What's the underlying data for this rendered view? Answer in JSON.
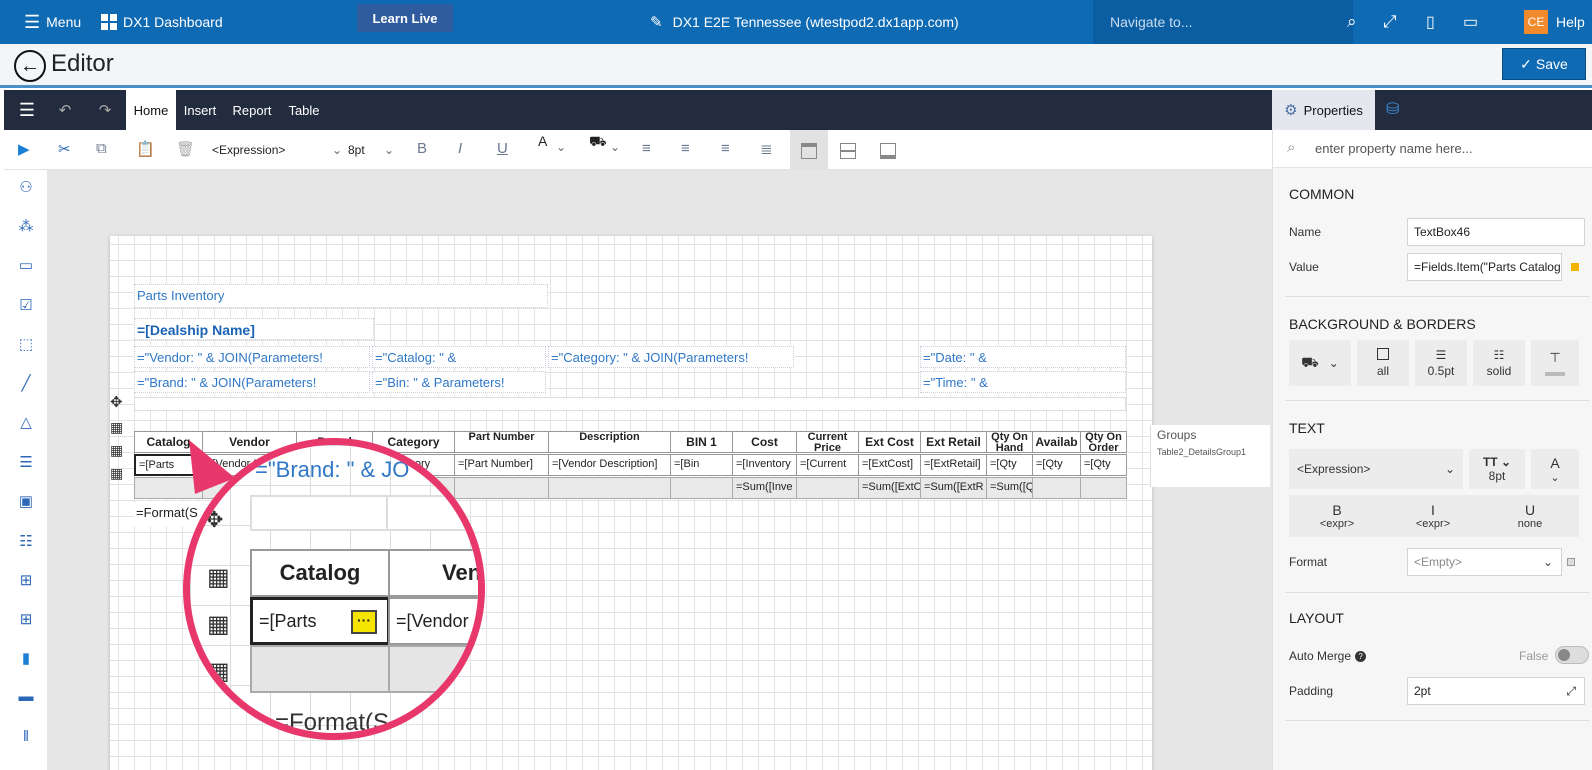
{
  "topbar": {
    "menu_label": "Menu",
    "dashboard_label": "DX1 Dashboard",
    "learn_live": "Learn Live",
    "site_title": "DX1 E2E Tennessee (wtestpod2.dx1app.com)",
    "navigate_placeholder": "Navigate to...",
    "avatar_initials": "CE",
    "help_label": "Help"
  },
  "editorbar": {
    "title": "Editor",
    "save_label": "Save"
  },
  "menu": {
    "tabs": [
      "Home",
      "Insert",
      "Report",
      "Table"
    ],
    "active": "Home"
  },
  "toolbar": {
    "expression_select": "<Expression>",
    "font_size": "8pt",
    "bold": "B",
    "italic": "I",
    "underline": "U",
    "font_color": "A"
  },
  "report": {
    "title": "Parts Inventory",
    "dealership": "=[Dealship Name]",
    "vendor_expr": "=\"Vendor: \" & JOIN(Parameters!",
    "catalog_expr": "=\"Catalog: \" &",
    "category_expr": "=\"Category: \" & JOIN(Parameters!",
    "date_expr": "=\"Date: \" &",
    "brand_expr": "=\"Brand: \" & JOIN(Parameters!",
    "bin_expr": "=\"Bin: \" & Parameters!",
    "time_expr": "=\"Time: \" &",
    "footer_expr": "=Format(S",
    "table": {
      "headers": [
        "Catalog",
        "Vendor",
        "Brand",
        "Category",
        "Part Number",
        "Description",
        "BIN 1",
        "Cost",
        "Current Price",
        "Ext Cost",
        "Ext Retail",
        "Qty On Hand",
        "Availab",
        "Qty On Order"
      ],
      "details": [
        "=[Parts",
        "=[Vendor Nam",
        "",
        "=[Category",
        "=[Part Number]",
        "=[Vendor Description]",
        "=[Bin",
        "=[Inventory",
        "=[Current",
        "=[ExtCost]",
        "=[ExtRetail]",
        "=[Qty",
        "=[Qty",
        "=[Qty"
      ],
      "footer": [
        "",
        "",
        "",
        "",
        "",
        "",
        "",
        "=Sum([Inve",
        "",
        "=Sum([ExtC",
        "=Sum([ExtR",
        "=Sum([Q",
        "",
        ""
      ]
    }
  },
  "groups": {
    "title": "Groups",
    "item": "Table2_DetailsGroup1"
  },
  "magnifier": {
    "brand_expr": "=\"Brand: \" & JO",
    "catalog": "Catalog",
    "vendor": "Vend",
    "parts": "=[Parts",
    "vendor_cell": "=[Vendor",
    "footer": "=Format(S"
  },
  "properties": {
    "tab_label": "Properties",
    "search_placeholder": "enter property name here...",
    "common": {
      "title": "COMMON",
      "name_label": "Name",
      "name_value": "TextBox46",
      "value_label": "Value",
      "value_value": "=Fields.Item(\"Parts Catalog"
    },
    "background": {
      "title": "BACKGROUND & BORDERS",
      "all": "all",
      "width": "0.5pt",
      "style": "solid"
    },
    "text": {
      "title": "TEXT",
      "expression": "<Expression>",
      "size": "8pt",
      "color_glyph": "A",
      "bold": "B",
      "bold_sub": "<expr>",
      "italic": "I",
      "italic_sub": "<expr>",
      "underline": "U",
      "underline_sub": "none",
      "format_label": "Format",
      "format_value": "<Empty>"
    },
    "layout": {
      "title": "LAYOUT",
      "auto_merge_label": "Auto Merge",
      "auto_merge_value": "False",
      "padding_label": "Padding",
      "padding_value": "2pt"
    }
  },
  "colors": {
    "brand_blue": "#0f6ab4",
    "dark_bar": "#232c3f",
    "accent_pink": "#e8376b",
    "expr_blue": "#2f77c7"
  }
}
